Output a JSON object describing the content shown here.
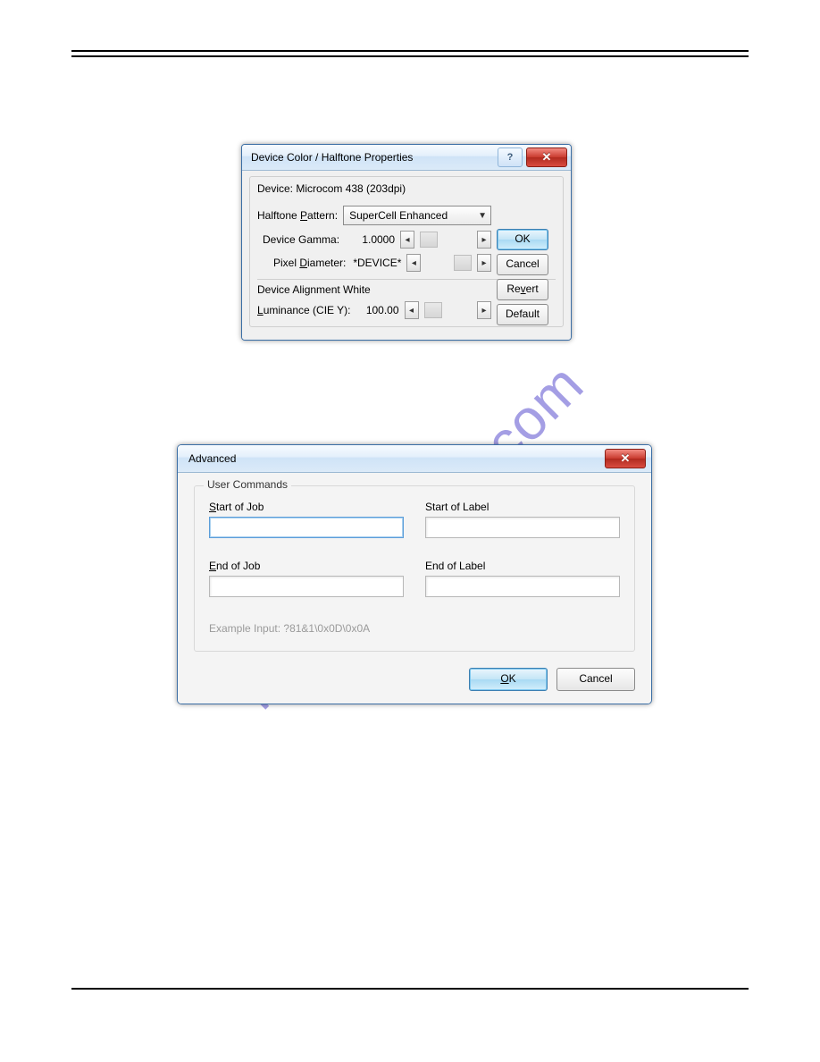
{
  "watermark": "manualshive.com",
  "dialog1": {
    "title": "Device Color / Halftone Properties",
    "device_line_label": "Device:",
    "device_line_value": "Microcom 438 (203dpi)",
    "halftone_label_prefix": "Halftone ",
    "halftone_label_ul": "P",
    "halftone_label_suffix": "attern:",
    "halftone_value": "SuperCell Enhanced",
    "gamma_label": "Device Gamma:",
    "gamma_value": "1.0000",
    "pixel_label_prefix": "Pixel ",
    "pixel_label_ul": "D",
    "pixel_label_suffix": "iameter:",
    "pixel_value": "*DEVICE*",
    "alignment_heading": "Device Alignment White",
    "luminance_label_ul": "L",
    "luminance_label_suffix": "uminance (CIE Y):",
    "luminance_value": "100.00",
    "help_symbol": "?",
    "close_symbol": "✕",
    "buttons": {
      "ok": "OK",
      "cancel": "Cancel",
      "revert_ul": "v",
      "revert_prefix": "Re",
      "revert_suffix": "ert",
      "default": "Default"
    }
  },
  "dialog2": {
    "title": "Advanced",
    "close_symbol": "✕",
    "group_legend": "User Commands",
    "fields": {
      "start_job_ul": "S",
      "start_job_suffix": "tart of Job",
      "start_label": "Start of Label",
      "end_job_ul": "E",
      "end_job_suffix": "nd of Job",
      "end_label": "End of Label"
    },
    "example_label": "Example Input:",
    "example_value": "?81&1\\0x0D\\0x0A",
    "buttons": {
      "ok_ul": "O",
      "ok_suffix": "K",
      "cancel": "Cancel"
    }
  }
}
